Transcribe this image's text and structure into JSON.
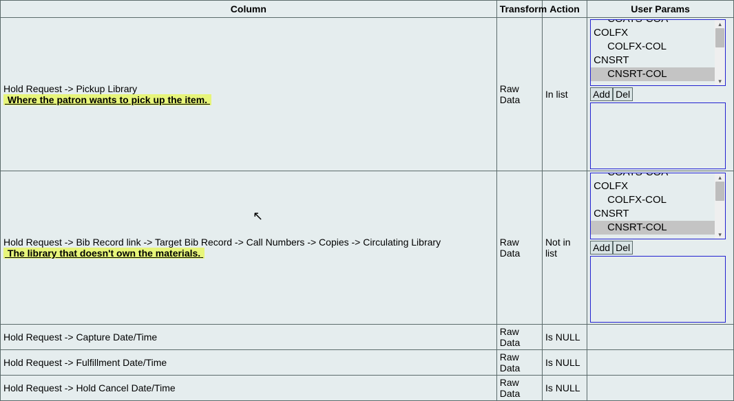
{
  "headers": {
    "column": "Column",
    "transform": "Transform",
    "action": "Action",
    "params": "User Params"
  },
  "rows": [
    {
      "column_main": "Hold Request -> Pickup Library",
      "column_note": "Where the patron wants to pick up the item.",
      "transform": "Raw Data",
      "action": "In list",
      "has_params": true
    },
    {
      "column_main": "Hold Request -> Bib Record link -> Target Bib Record -> Call Numbers -> Copies -> Circulating Library",
      "column_note": "The library that doesn't own the materials.",
      "transform": "Raw Data",
      "action": "Not in list",
      "has_params": true
    },
    {
      "column_main": "Hold Request -> Capture Date/Time",
      "transform": "Raw Data",
      "action": "Is NULL",
      "has_params": false
    },
    {
      "column_main": "Hold Request -> Fulfillment Date/Time",
      "transform": "Raw Data",
      "action": "Is NULL",
      "has_params": false
    },
    {
      "column_main": "Hold Request -> Hold Cancel Date/Time",
      "transform": "Raw Data",
      "action": "Is NULL",
      "has_params": false
    }
  ],
  "listbox": {
    "options": [
      {
        "label": "COATS-COA",
        "indent": true,
        "clip": true
      },
      {
        "label": "COLFX",
        "indent": false
      },
      {
        "label": "COLFX-COL",
        "indent": true
      },
      {
        "label": "CNSRT",
        "indent": false
      },
      {
        "label": "CNSRT-COL",
        "indent": true,
        "selected": true
      }
    ]
  },
  "buttons": {
    "add": "Add",
    "del": "Del"
  }
}
